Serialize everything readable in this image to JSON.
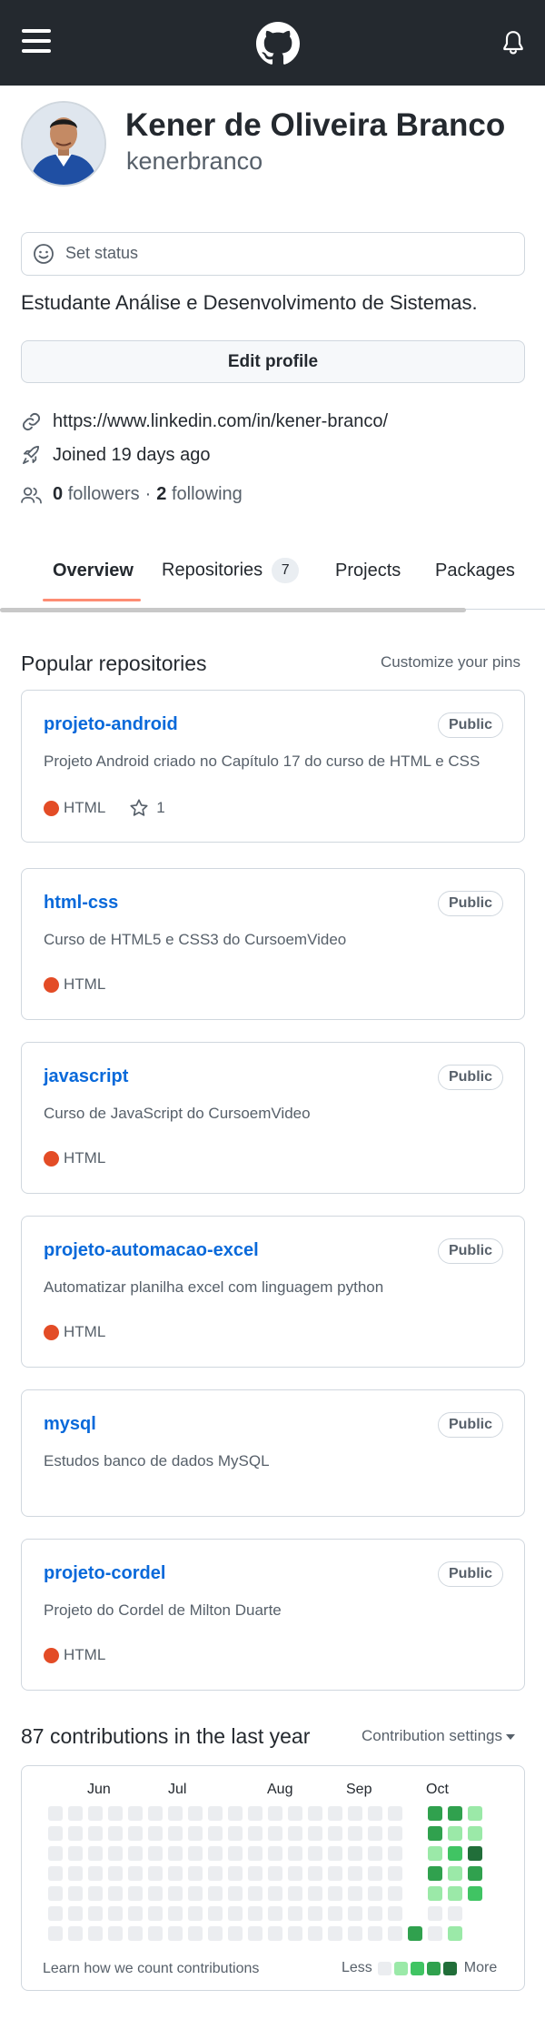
{
  "topbar": {
    "menu_icon": "hamburger-icon",
    "logo_icon": "github-octocat-icon",
    "notification_icon": "bell-icon"
  },
  "profile": {
    "name": "Kener de Oliveira Branco",
    "login": "kenerbranco",
    "status_label": "Set status",
    "bio": "Estudante Análise e Desenvolvimento de Sistemas.",
    "edit_label": "Edit profile",
    "website": "https://www.linkedin.com/in/kener-branco/",
    "joined": "Joined 19 days ago",
    "followers_count": "0",
    "followers_label": "followers",
    "separator": "·",
    "following_count": "2",
    "following_label": "following"
  },
  "tabs": {
    "overview": "Overview",
    "repositories": "Repositories",
    "repositories_count": "7",
    "projects": "Projects",
    "packages": "Packages"
  },
  "popular": {
    "title": "Popular repositories",
    "customize_label": "Customize your pins",
    "repos": [
      {
        "name": "projeto-android",
        "visibility": "Public",
        "description": "Projeto Android criado no Capítulo 17 do curso de HTML e CSS",
        "language": "HTML",
        "stars": "1"
      },
      {
        "name": "html-css",
        "visibility": "Public",
        "description": "Curso de HTML5 e CSS3 do CursoemVideo",
        "language": "HTML"
      },
      {
        "name": "javascript",
        "visibility": "Public",
        "description": "Curso de JavaScript do CursoemVideo",
        "language": "HTML"
      },
      {
        "name": "projeto-automacao-excel",
        "visibility": "Public",
        "description": "Automatizar planilha excel com linguagem python",
        "language": "HTML"
      },
      {
        "name": "mysql",
        "visibility": "Public",
        "description": "Estudos banco de dados MySQL"
      },
      {
        "name": "projeto-cordel",
        "visibility": "Public",
        "description": "Projeto do Cordel de Milton Duarte",
        "language": "HTML"
      }
    ]
  },
  "contributions": {
    "title": "87 contributions in the last year",
    "settings_label": "Contribution settings",
    "months": [
      "Jun",
      "Jul",
      "Aug",
      "Sep",
      "Oct"
    ],
    "learn_label": "Learn how we count contributions",
    "legend_less": "Less",
    "legend_more": "More",
    "colors": [
      "#ebedf0",
      "#9be9a8",
      "#40c463",
      "#30a14e",
      "#216e39"
    ],
    "active_weeks": [
      [
        null,
        null,
        null,
        null,
        null,
        null,
        3
      ],
      [
        3,
        3,
        1,
        3,
        1,
        0,
        0
      ],
      [
        3,
        1,
        2,
        1,
        1,
        0,
        1
      ],
      [
        1,
        1,
        4,
        3,
        2,
        null,
        null
      ]
    ],
    "language_color": "#e34c26",
    "link_color": "#0969da"
  }
}
